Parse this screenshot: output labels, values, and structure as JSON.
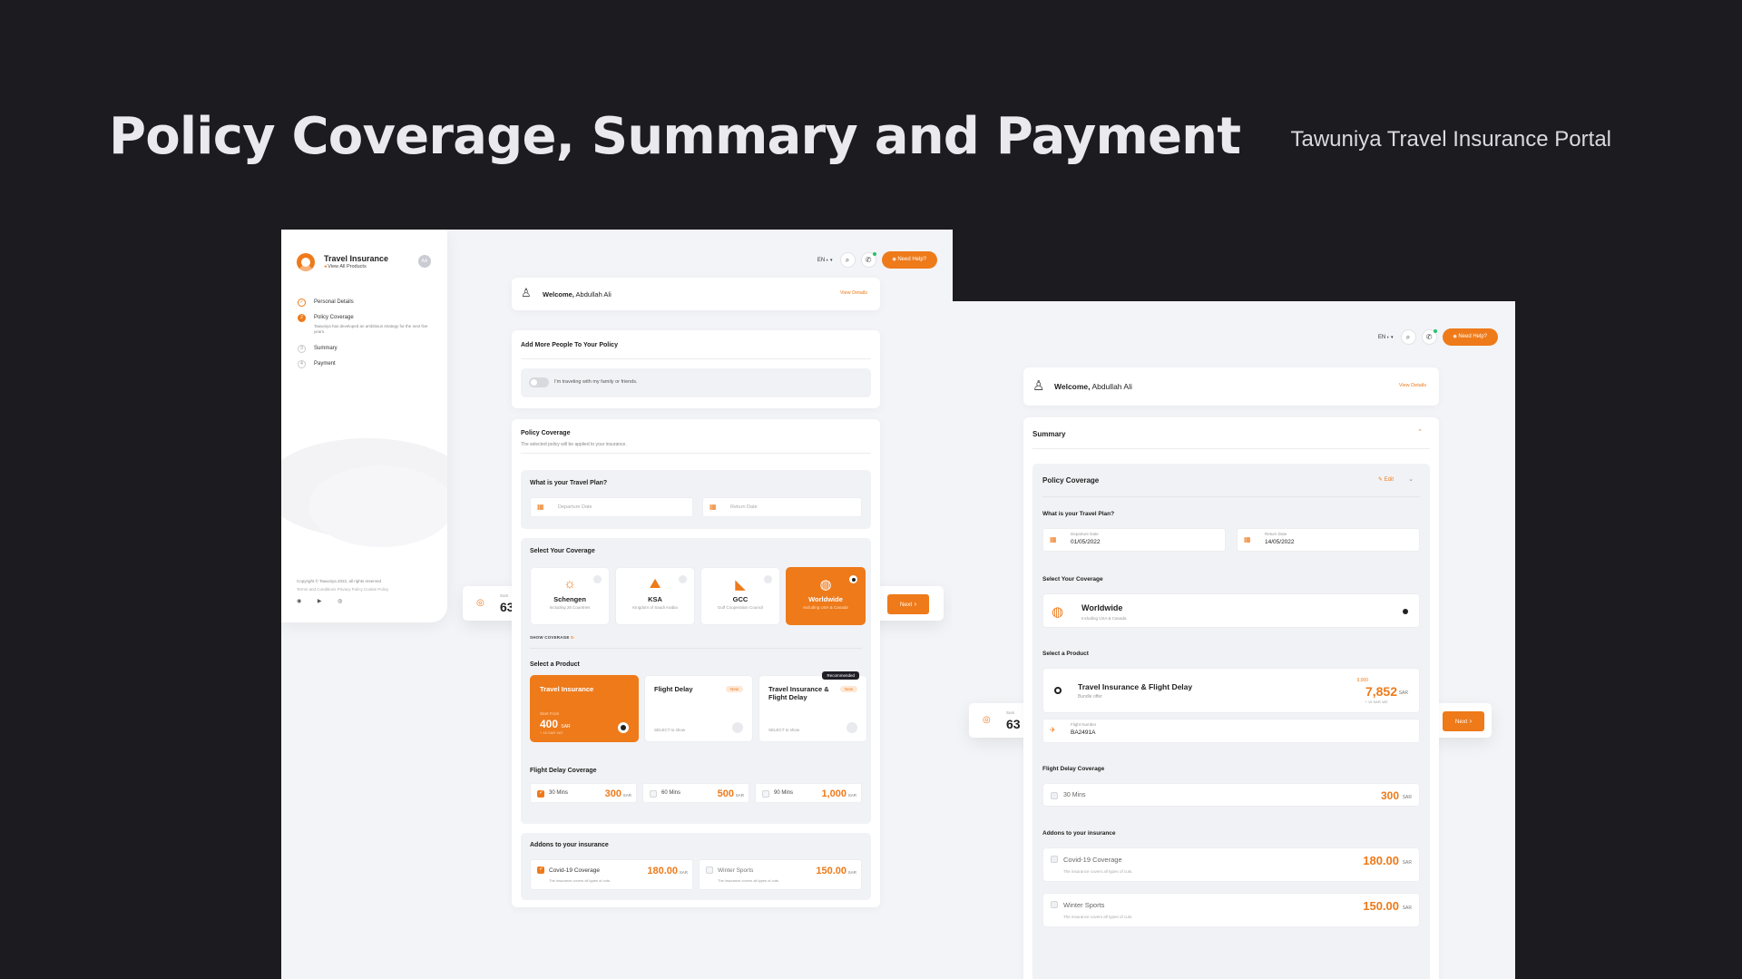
{
  "header": {
    "title": "Policy Coverage, Summary and Payment",
    "subtitle": "Tawuniya Travel Insurance Portal"
  },
  "colors": {
    "accent": "#ee7a1a",
    "background": "#1c1b1f",
    "screen": "#f3f4f7"
  },
  "topbar": {
    "lang": "EN",
    "search_icon": "search-icon",
    "phone_icon": "phone-icon",
    "help_label": "Need Help?"
  },
  "welcome": {
    "greeting": "Welcome,",
    "name": "Abdullah Ali",
    "view_details": "View Details"
  },
  "screen1": {
    "sidebar": {
      "brand": "Travel Insurance",
      "back_link": "View All Products",
      "avatar": "AA",
      "steps": [
        {
          "label": "Personal Details",
          "state": "done",
          "num": "✓"
        },
        {
          "label": "Policy Coverage",
          "state": "active",
          "num": "2",
          "desc": "Tawuniya has developed an ambitious strategy for the next five years."
        },
        {
          "label": "Summary",
          "state": "todo",
          "num": "3"
        },
        {
          "label": "Payment",
          "state": "todo",
          "num": "4"
        }
      ],
      "copyright": "Copyright © Tawuniya 2022, all rights reserved",
      "footer_links": "Terms and Conditions   Privacy Policy   Cookie Policy",
      "socials": "◉ ▶ ◎"
    },
    "add_people": {
      "title": "Add More People To Your Policy",
      "toggle_label": "I'm traveling with my family or friends."
    },
    "policy": {
      "title": "Policy Coverage",
      "desc": "The selected policy will be applied to your insurance.",
      "travel_plan_q": "What is your Travel Plan?",
      "departure_ph": "Departure Date",
      "return_ph": "Return Date",
      "select_coverage": "Select Your Coverage",
      "coverages": [
        {
          "name": "Schengen",
          "sub": "Including 26 Countries",
          "icon": "☼",
          "selected": false
        },
        {
          "name": "KSA",
          "sub": "Kingdom of Saudi Arabia",
          "icon": "⛰",
          "selected": false
        },
        {
          "name": "GCC",
          "sub": "Gulf Cooperation Council",
          "icon": "◣",
          "selected": false
        },
        {
          "name": "Worldwide",
          "sub": "Including USA & Canada",
          "icon": "◍",
          "selected": true
        }
      ],
      "show_coverage": "SHOW COVERAGE",
      "select_product": "Select a Product",
      "products": [
        {
          "name": "Travel Insurance",
          "from": "Start From",
          "price": "400",
          "unit": "SAR",
          "vat": "+ 15 SAR VAT",
          "selected": true
        },
        {
          "name": "Flight Delay",
          "badge": "New",
          "select": "SELECT to show",
          "selected": false
        },
        {
          "name": "Travel Insurance & Flight Delay",
          "badge": "New",
          "select": "SELECT to show",
          "recommended": "Recommended",
          "selected": false
        }
      ],
      "flight_delay_title": "Flight Delay Coverage",
      "delays": [
        {
          "label": "30 Mins",
          "value": "300",
          "unit": "SAR",
          "checked": true
        },
        {
          "label": "60 Mins",
          "value": "500",
          "unit": "SAR",
          "checked": false
        },
        {
          "label": "90 Mins",
          "value": "1,000",
          "unit": "SAR",
          "checked": false
        }
      ],
      "addons_title": "Addons to your insurance",
      "addons": [
        {
          "label": "Covid-19 Coverage",
          "desc": "The insurance covers all types of cuts.",
          "value": "180.00",
          "unit": "SAR",
          "checked": true
        },
        {
          "label": "Winter Sports",
          "desc": "The insurance covers all types of cuts.",
          "value": "150.00",
          "unit": "SAR",
          "checked": false
        }
      ]
    },
    "summary_bar": {
      "label": "Sum",
      "value": "63",
      "next": "Next"
    }
  },
  "screen2": {
    "summary_title": "Summary",
    "policy_title": "Policy Coverage",
    "edit": "Edit",
    "travel_plan_q": "What is your Travel Plan?",
    "departure_label": "Departure Date",
    "departure_value": "01/05/2022",
    "return_label": "Return Date",
    "return_value": "14/05/2022",
    "select_coverage": "Select Your Coverage",
    "coverage_name": "Worldwide",
    "coverage_sub": "Including USA & Canada",
    "select_product": "Select a Product",
    "product_name": "Travel Insurance & Flight Delay",
    "product_sub": "Bundle offer",
    "product_old": "9,000",
    "product_price": "7,852",
    "product_unit": "SAR",
    "product_vat": "+ 15 SAR VAT",
    "flight_number_label": "Flight Number",
    "flight_number": "BA2491A",
    "flight_delay_title": "Flight Delay Coverage",
    "delay_label": "30 Mins",
    "delay_value": "300",
    "delay_unit": "SAR",
    "addons_title": "Addons to your insurance",
    "addons": [
      {
        "label": "Covid-19 Coverage",
        "desc": "The insurance covers all types of cuts.",
        "value": "180.00",
        "unit": "SAR"
      },
      {
        "label": "Winter Sports",
        "desc": "The insurance covers all types of cuts.",
        "value": "150.00",
        "unit": "SAR"
      }
    ],
    "summary_bar": {
      "label": "Sum",
      "value": "63",
      "next": "Next"
    }
  }
}
